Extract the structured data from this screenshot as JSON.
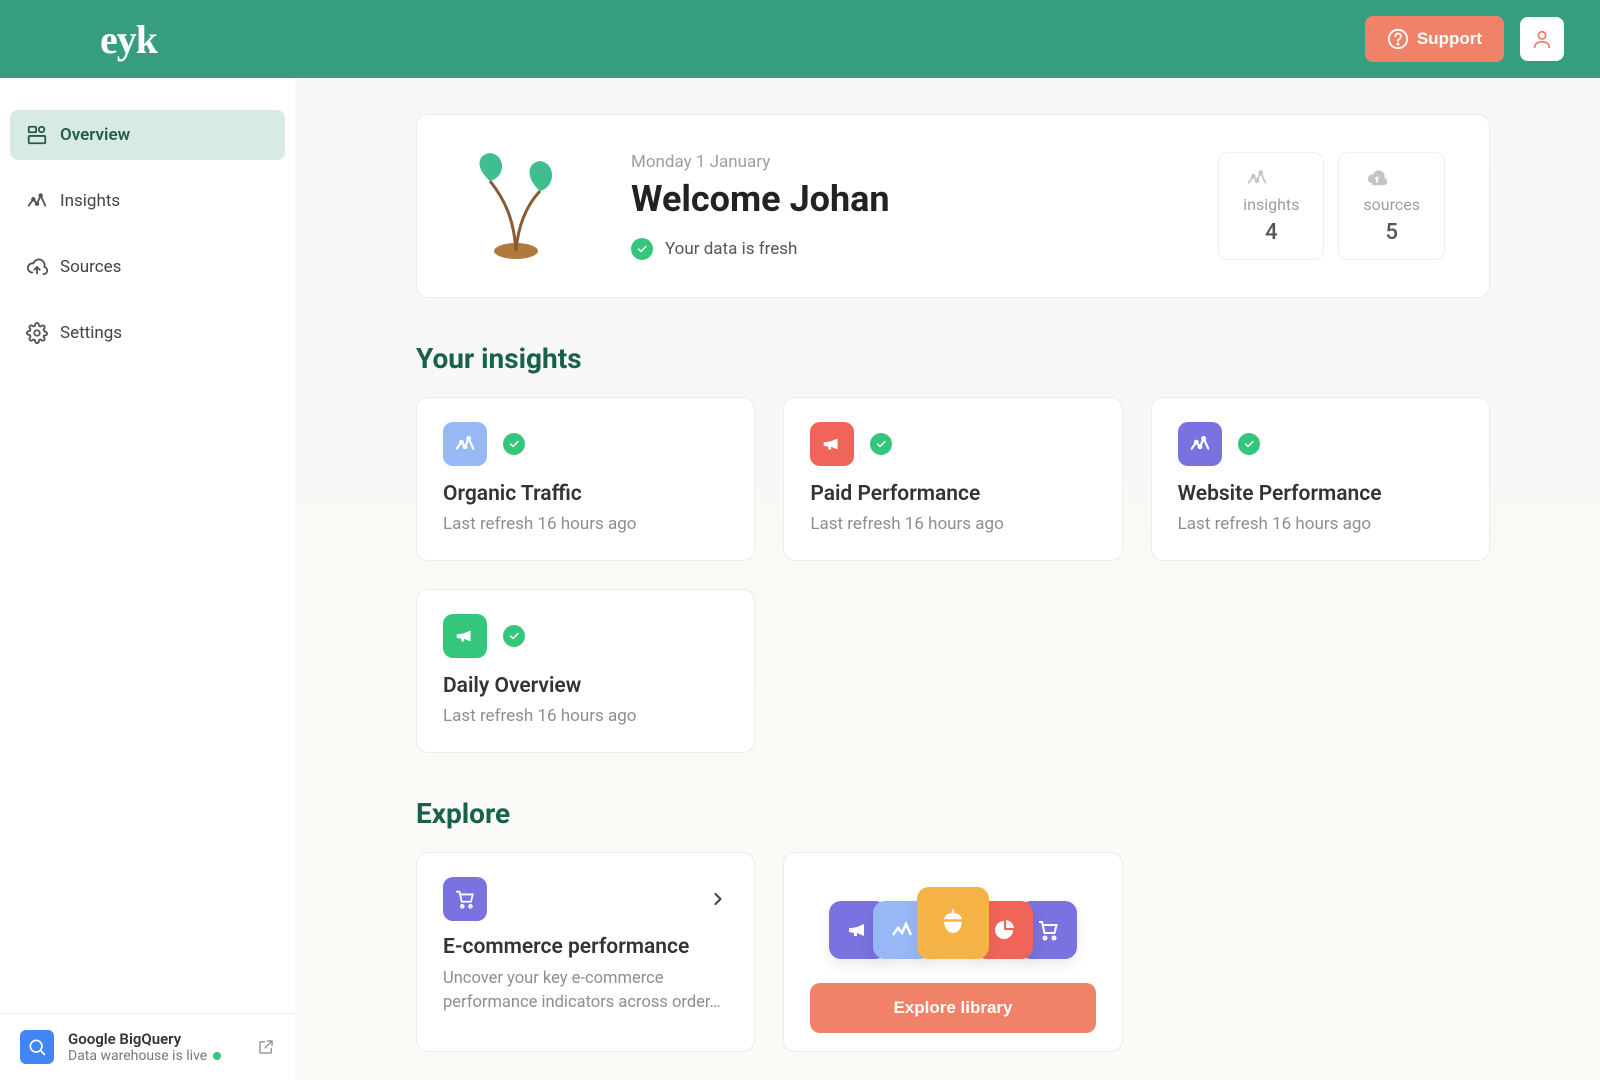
{
  "brand": "eyk",
  "header": {
    "support_label": "Support"
  },
  "sidebar": {
    "items": [
      {
        "label": "Overview",
        "icon": "dashboard-icon",
        "active": true
      },
      {
        "label": "Insights",
        "icon": "insights-icon",
        "active": false
      },
      {
        "label": "Sources",
        "icon": "cloud-up-icon",
        "active": false
      },
      {
        "label": "Settings",
        "icon": "gear-icon",
        "active": false
      }
    ],
    "footer": {
      "title": "Google BigQuery",
      "status": "Data warehouse is live"
    }
  },
  "welcome": {
    "date": "Monday 1 January",
    "title": "Welcome Johan",
    "fresh_label": "Your data is fresh",
    "stats": [
      {
        "label": "insights",
        "value": "4",
        "icon": "insights-icon"
      },
      {
        "label": "sources",
        "value": "5",
        "icon": "cloud-up-icon"
      }
    ]
  },
  "insights_section": {
    "title": "Your insights",
    "cards": [
      {
        "title": "Organic Traffic",
        "sub": "Last refresh 16 hours ago",
        "icon_color": "ic-blue",
        "icon": "insights-icon"
      },
      {
        "title": "Paid Performance",
        "sub": "Last refresh 16 hours ago",
        "icon_color": "ic-red",
        "icon": "megaphone-icon"
      },
      {
        "title": "Website Performance",
        "sub": "Last refresh 16 hours ago",
        "icon_color": "ic-purple",
        "icon": "insights-icon"
      },
      {
        "title": "Daily Overview",
        "sub": "Last refresh 16 hours ago",
        "icon_color": "ic-green",
        "icon": "megaphone-icon"
      }
    ]
  },
  "explore_section": {
    "title": "Explore",
    "feature": {
      "title": "E-commerce performance",
      "desc": "Uncover your key e-commerce performance indicators across order…",
      "icon_color": "ic-purple",
      "icon": "cart-icon"
    },
    "library_button": "Explore library"
  }
}
